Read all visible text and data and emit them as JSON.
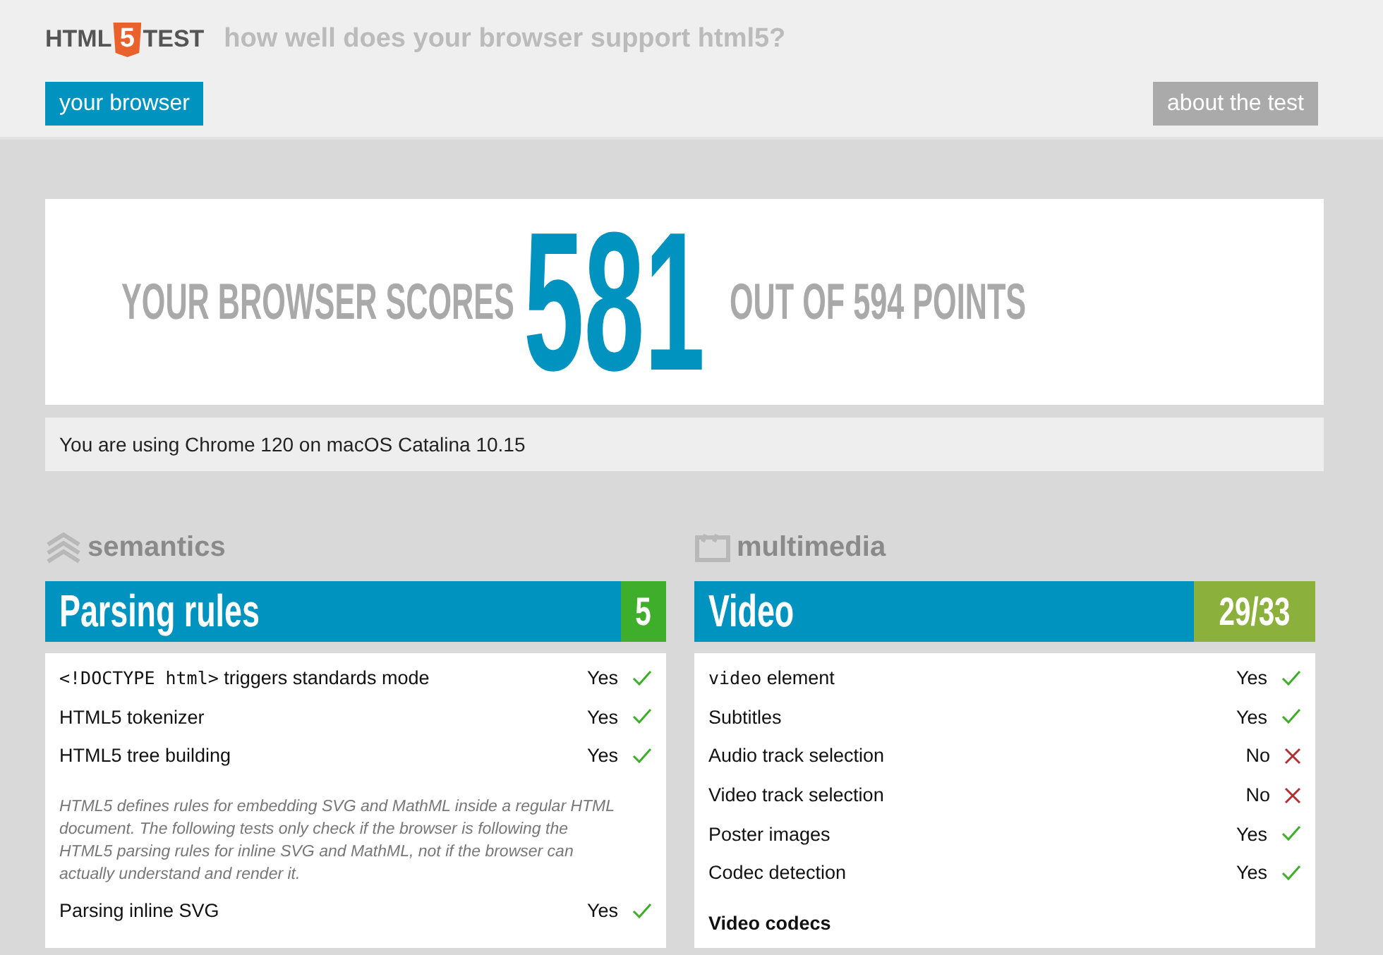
{
  "header": {
    "logo": {
      "left": "HTML",
      "badge": "5",
      "right": "TEST"
    },
    "tagline": "how well does your browser support html5?",
    "nav": [
      {
        "label": "your browser",
        "selected": true
      },
      {
        "label": "about the test",
        "selected": false
      }
    ]
  },
  "score": {
    "prefix": "YOUR BROWSER SCORES",
    "value": "581",
    "suffix": "OUT OF 594 POINTS"
  },
  "info": "You are using Chrome 120 on macOS Catalina 10.15",
  "sections": [
    {
      "category": "semantics",
      "title": "Parsing rules",
      "points": "5",
      "complete": true,
      "rows": [
        {
          "kind": "test",
          "code": "<!DOCTYPE html>",
          "label": " triggers standards mode",
          "result": "Yes",
          "passed": true
        },
        {
          "kind": "test",
          "label": "HTML5 tokenizer",
          "result": "Yes",
          "passed": true
        },
        {
          "kind": "test",
          "label": "HTML5 tree building",
          "result": "Yes",
          "passed": true
        },
        {
          "kind": "note",
          "label": "HTML5 defines rules for embedding SVG and MathML inside a regular HTML document. The following tests only check if the browser is following the HTML5 parsing rules for inline SVG and MathML, not if the browser can actually understand and render it."
        },
        {
          "kind": "test",
          "label": "Parsing inline SVG",
          "result": "Yes",
          "passed": true
        }
      ]
    },
    {
      "category": "multimedia",
      "title": "Video",
      "points": "29/33",
      "complete": false,
      "rows": [
        {
          "kind": "test",
          "code": "video",
          "label": " element",
          "result": "Yes",
          "passed": true
        },
        {
          "kind": "test",
          "label": "Subtitles",
          "result": "Yes",
          "passed": true
        },
        {
          "kind": "test",
          "label": "Audio track selection",
          "result": "No",
          "passed": false
        },
        {
          "kind": "test",
          "label": "Video track selection",
          "result": "No",
          "passed": false
        },
        {
          "kind": "test",
          "label": "Poster images",
          "result": "Yes",
          "passed": true
        },
        {
          "kind": "test",
          "label": "Codec detection",
          "result": "Yes",
          "passed": true
        },
        {
          "kind": "heading",
          "label": "Video codecs"
        }
      ]
    }
  ]
}
